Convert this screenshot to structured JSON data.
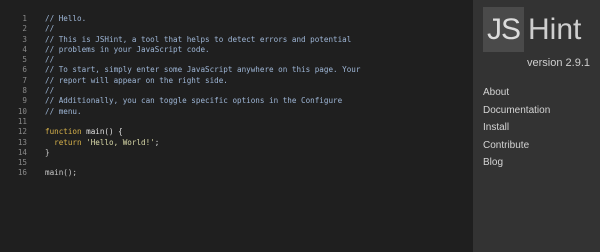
{
  "editor": {
    "lines": [
      {
        "n": "1",
        "text": "// Hello."
      },
      {
        "n": "2",
        "text": "//"
      },
      {
        "n": "3",
        "text": "// This is JSHint, a tool that helps to detect errors and potential"
      },
      {
        "n": "4",
        "text": "// problems in your JavaScript code."
      },
      {
        "n": "5",
        "text": "//"
      },
      {
        "n": "6",
        "text": "// To start, simply enter some JavaScript anywhere on this page. Your"
      },
      {
        "n": "7",
        "text": "// report will appear on the right side."
      },
      {
        "n": "8",
        "text": "//"
      },
      {
        "n": "9",
        "text": "// Additionally, you can toggle specific options in the Configure"
      },
      {
        "n": "10",
        "text": "// menu."
      },
      {
        "n": "11",
        "text": ""
      },
      {
        "n": "12",
        "kw": "function",
        "rest": " main() {"
      },
      {
        "n": "13",
        "kw": "  return",
        "str": " 'Hello, World!'",
        "rest": ";"
      },
      {
        "n": "14",
        "text": "}"
      },
      {
        "n": "15",
        "text": ""
      },
      {
        "n": "16",
        "text": "main();"
      }
    ]
  },
  "sidebar": {
    "logo_js": "JS",
    "logo_hint": "Hint",
    "version": "version 2.9.1",
    "nav": [
      "About",
      "Documentation",
      "Install",
      "Contribute",
      "Blog"
    ]
  }
}
